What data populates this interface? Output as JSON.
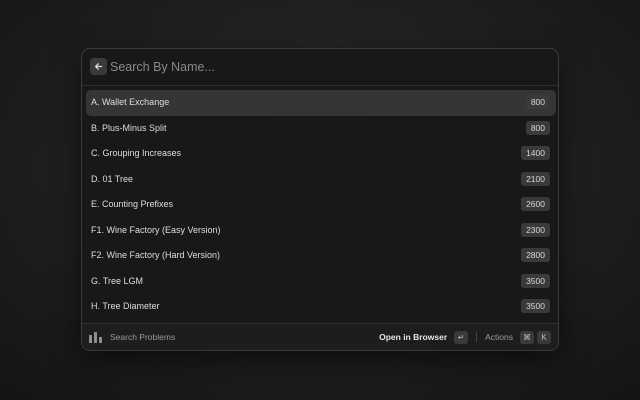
{
  "search": {
    "placeholder": "Search By Name..."
  },
  "problems": [
    {
      "label": "A. Wallet Exchange",
      "rating": "800"
    },
    {
      "label": "B. Plus-Minus Split",
      "rating": "800"
    },
    {
      "label": "C. Grouping Increases",
      "rating": "1400"
    },
    {
      "label": "D. 01 Tree",
      "rating": "2100"
    },
    {
      "label": "E. Counting Prefixes",
      "rating": "2600"
    },
    {
      "label": "F1. Wine Factory (Easy Version)",
      "rating": "2300"
    },
    {
      "label": "F2. Wine Factory (Hard Version)",
      "rating": "2800"
    },
    {
      "label": "G. Tree LGM",
      "rating": "3500"
    },
    {
      "label": "H. Tree Diameter",
      "rating": "3500"
    }
  ],
  "selected_index": 0,
  "footer": {
    "left_label": "Search Problems",
    "primary_action": "Open in Browser",
    "enter_key": "↵",
    "actions_label": "Actions",
    "cmd_key": "⌘",
    "k_key": "K"
  },
  "icons": {
    "back": "arrow-left-icon",
    "command": "bar-chart-icon"
  }
}
